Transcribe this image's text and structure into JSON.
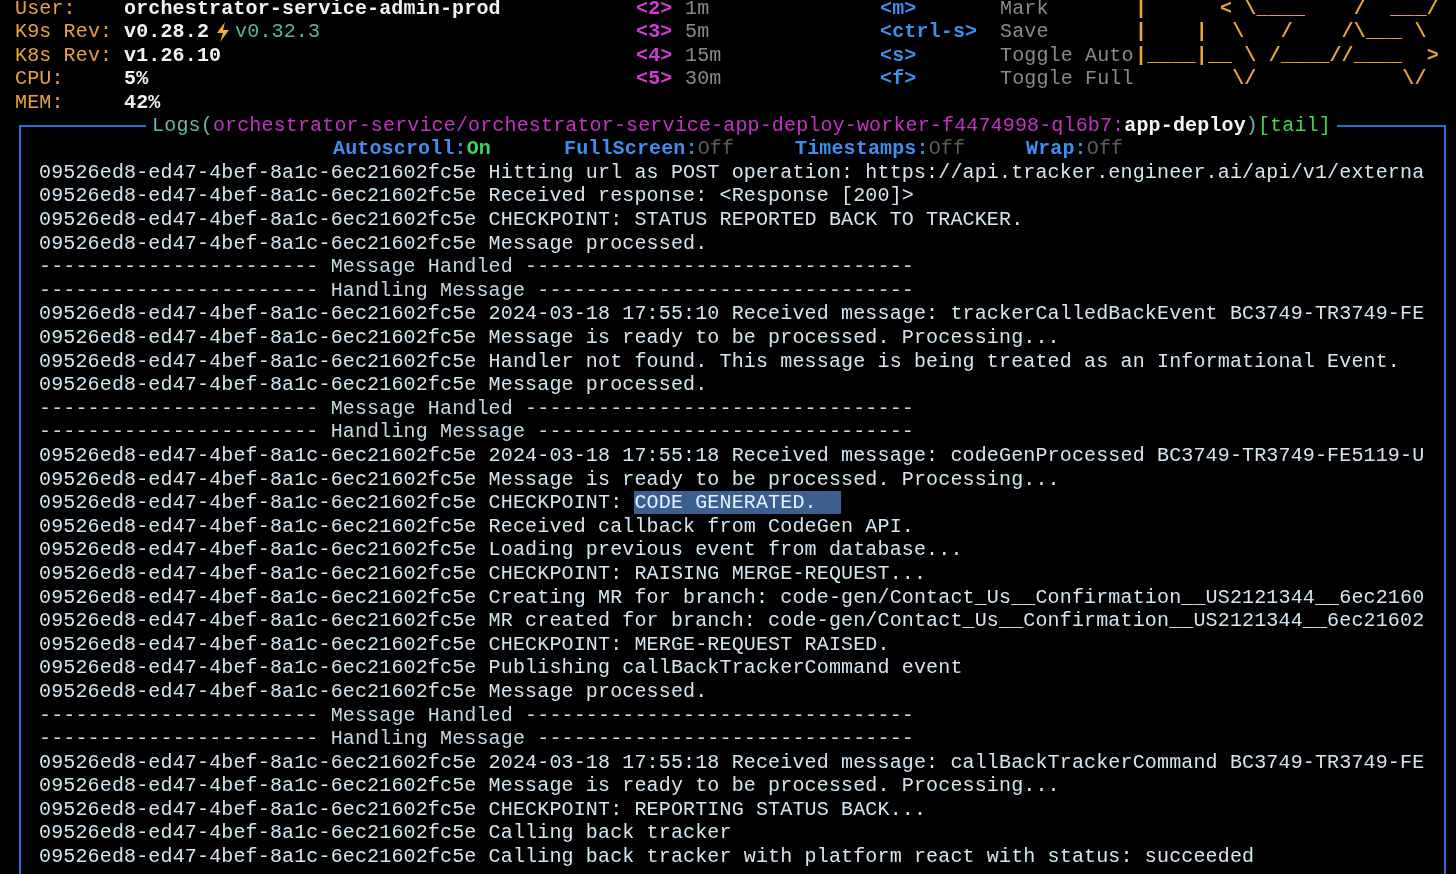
{
  "header": {
    "info": [
      {
        "label": "User:",
        "value": "orchestrator-service-admin-prod"
      },
      {
        "label": "K9s Rev:",
        "value": "v0.28.2",
        "update": "v0.32.3"
      },
      {
        "label": "K8s Rev:",
        "value": "v1.26.10"
      },
      {
        "label": "CPU:",
        "value": "5%"
      },
      {
        "label": "MEM:",
        "value": "42%"
      }
    ],
    "ranges": [
      {
        "key": "<2>",
        "label": "1m"
      },
      {
        "key": "<3>",
        "label": "5m"
      },
      {
        "key": "<4>",
        "label": "15m"
      },
      {
        "key": "<5>",
        "label": "30m"
      }
    ],
    "shortcuts": [
      {
        "key": "<m>",
        "label": "Mark"
      },
      {
        "key": "<ctrl-s>",
        "label": "Save"
      },
      {
        "key": "<s>",
        "label": "Toggle Auto"
      },
      {
        "key": "<f>",
        "label": "Toggle Full"
      }
    ],
    "logo": [
      "|      < \\____    /  ___/",
      "|    |  \\   /    /\\___ \\",
      "|____|__ \\ /____//____  >",
      "        \\/            \\/"
    ]
  },
  "logs": {
    "title": {
      "prefix": "Logs(",
      "path": "orchestrator-service/orchestrator-service-app-deploy-worker-f4474998-ql6b7:",
      "container": "app-deploy",
      "suffix": ")",
      "mode": "[tail]"
    },
    "toggles": [
      {
        "label": "Autoscroll:",
        "value": "On",
        "on": true
      },
      {
        "label": "FullScreen:",
        "value": "Off",
        "on": false
      },
      {
        "label": "Timestamps:",
        "value": "Off",
        "on": false
      },
      {
        "label": "Wrap:",
        "value": "Off",
        "on": false
      }
    ],
    "lines": [
      {
        "kind": "log",
        "text": "09526ed8-ed47-4bef-8a1c-6ec21602fc5e Hitting url as POST operation: https://api.tracker.engineer.ai/api/v1/externa"
      },
      {
        "kind": "log",
        "text": "09526ed8-ed47-4bef-8a1c-6ec21602fc5e Received response: <Response [200]>"
      },
      {
        "kind": "log",
        "text": "09526ed8-ed47-4bef-8a1c-6ec21602fc5e CHECKPOINT: STATUS REPORTED BACK TO TRACKER."
      },
      {
        "kind": "log",
        "text": "09526ed8-ed47-4bef-8a1c-6ec21602fc5e Message processed."
      },
      {
        "kind": "separator",
        "text": "----------------------- Message Handled --------------------------------"
      },
      {
        "kind": "separator",
        "text": "----------------------- Handling Message -------------------------------"
      },
      {
        "kind": "log",
        "text": "09526ed8-ed47-4bef-8a1c-6ec21602fc5e 2024-03-18 17:55:10 Received message: trackerCalledBackEvent BC3749-TR3749-FE"
      },
      {
        "kind": "log",
        "text": "09526ed8-ed47-4bef-8a1c-6ec21602fc5e Message is ready to be processed. Processing..."
      },
      {
        "kind": "log",
        "text": "09526ed8-ed47-4bef-8a1c-6ec21602fc5e Handler not found. This message is being treated as an Informational Event."
      },
      {
        "kind": "log",
        "text": "09526ed8-ed47-4bef-8a1c-6ec21602fc5e Message processed."
      },
      {
        "kind": "separator",
        "text": "----------------------- Message Handled --------------------------------"
      },
      {
        "kind": "separator",
        "text": "----------------------- Handling Message -------------------------------"
      },
      {
        "kind": "log",
        "text": "09526ed8-ed47-4bef-8a1c-6ec21602fc5e 2024-03-18 17:55:18 Received message: codeGenProcessed BC3749-TR3749-FE5119-U"
      },
      {
        "kind": "log",
        "text": "09526ed8-ed47-4bef-8a1c-6ec21602fc5e Message is ready to be processed. Processing..."
      },
      {
        "kind": "log",
        "text": "09526ed8-ed47-4bef-8a1c-6ec21602fc5e CHECKPOINT: ",
        "selection": "CODE GENERATED."
      },
      {
        "kind": "log",
        "text": "09526ed8-ed47-4bef-8a1c-6ec21602fc5e Received callback from CodeGen API."
      },
      {
        "kind": "log",
        "text": "09526ed8-ed47-4bef-8a1c-6ec21602fc5e Loading previous event from database..."
      },
      {
        "kind": "log",
        "text": "09526ed8-ed47-4bef-8a1c-6ec21602fc5e CHECKPOINT: RAISING MERGE-REQUEST..."
      },
      {
        "kind": "log",
        "text": "09526ed8-ed47-4bef-8a1c-6ec21602fc5e Creating MR for branch: code-gen/Contact_Us__Confirmation__US2121344__6ec2160"
      },
      {
        "kind": "log",
        "text": "09526ed8-ed47-4bef-8a1c-6ec21602fc5e MR created for branch: code-gen/Contact_Us__Confirmation__US2121344__6ec21602"
      },
      {
        "kind": "log",
        "text": "09526ed8-ed47-4bef-8a1c-6ec21602fc5e CHECKPOINT: MERGE-REQUEST RAISED."
      },
      {
        "kind": "log",
        "text": "09526ed8-ed47-4bef-8a1c-6ec21602fc5e Publishing callBackTrackerCommand event"
      },
      {
        "kind": "log",
        "text": "09526ed8-ed47-4bef-8a1c-6ec21602fc5e Message processed."
      },
      {
        "kind": "separator",
        "text": "----------------------- Message Handled --------------------------------"
      },
      {
        "kind": "separator",
        "text": "----------------------- Handling Message -------------------------------"
      },
      {
        "kind": "log",
        "text": "09526ed8-ed47-4bef-8a1c-6ec21602fc5e 2024-03-18 17:55:18 Received message: callBackTrackerCommand BC3749-TR3749-FE"
      },
      {
        "kind": "log",
        "text": "09526ed8-ed47-4bef-8a1c-6ec21602fc5e Message is ready to be processed. Processing..."
      },
      {
        "kind": "log",
        "text": "09526ed8-ed47-4bef-8a1c-6ec21602fc5e CHECKPOINT: REPORTING STATUS BACK..."
      },
      {
        "kind": "log",
        "text": "09526ed8-ed47-4bef-8a1c-6ec21602fc5e Calling back tracker"
      },
      {
        "kind": "log",
        "text": "09526ed8-ed47-4bef-8a1c-6ec21602fc5e Calling back tracker with platform react with status: succeeded"
      }
    ]
  }
}
